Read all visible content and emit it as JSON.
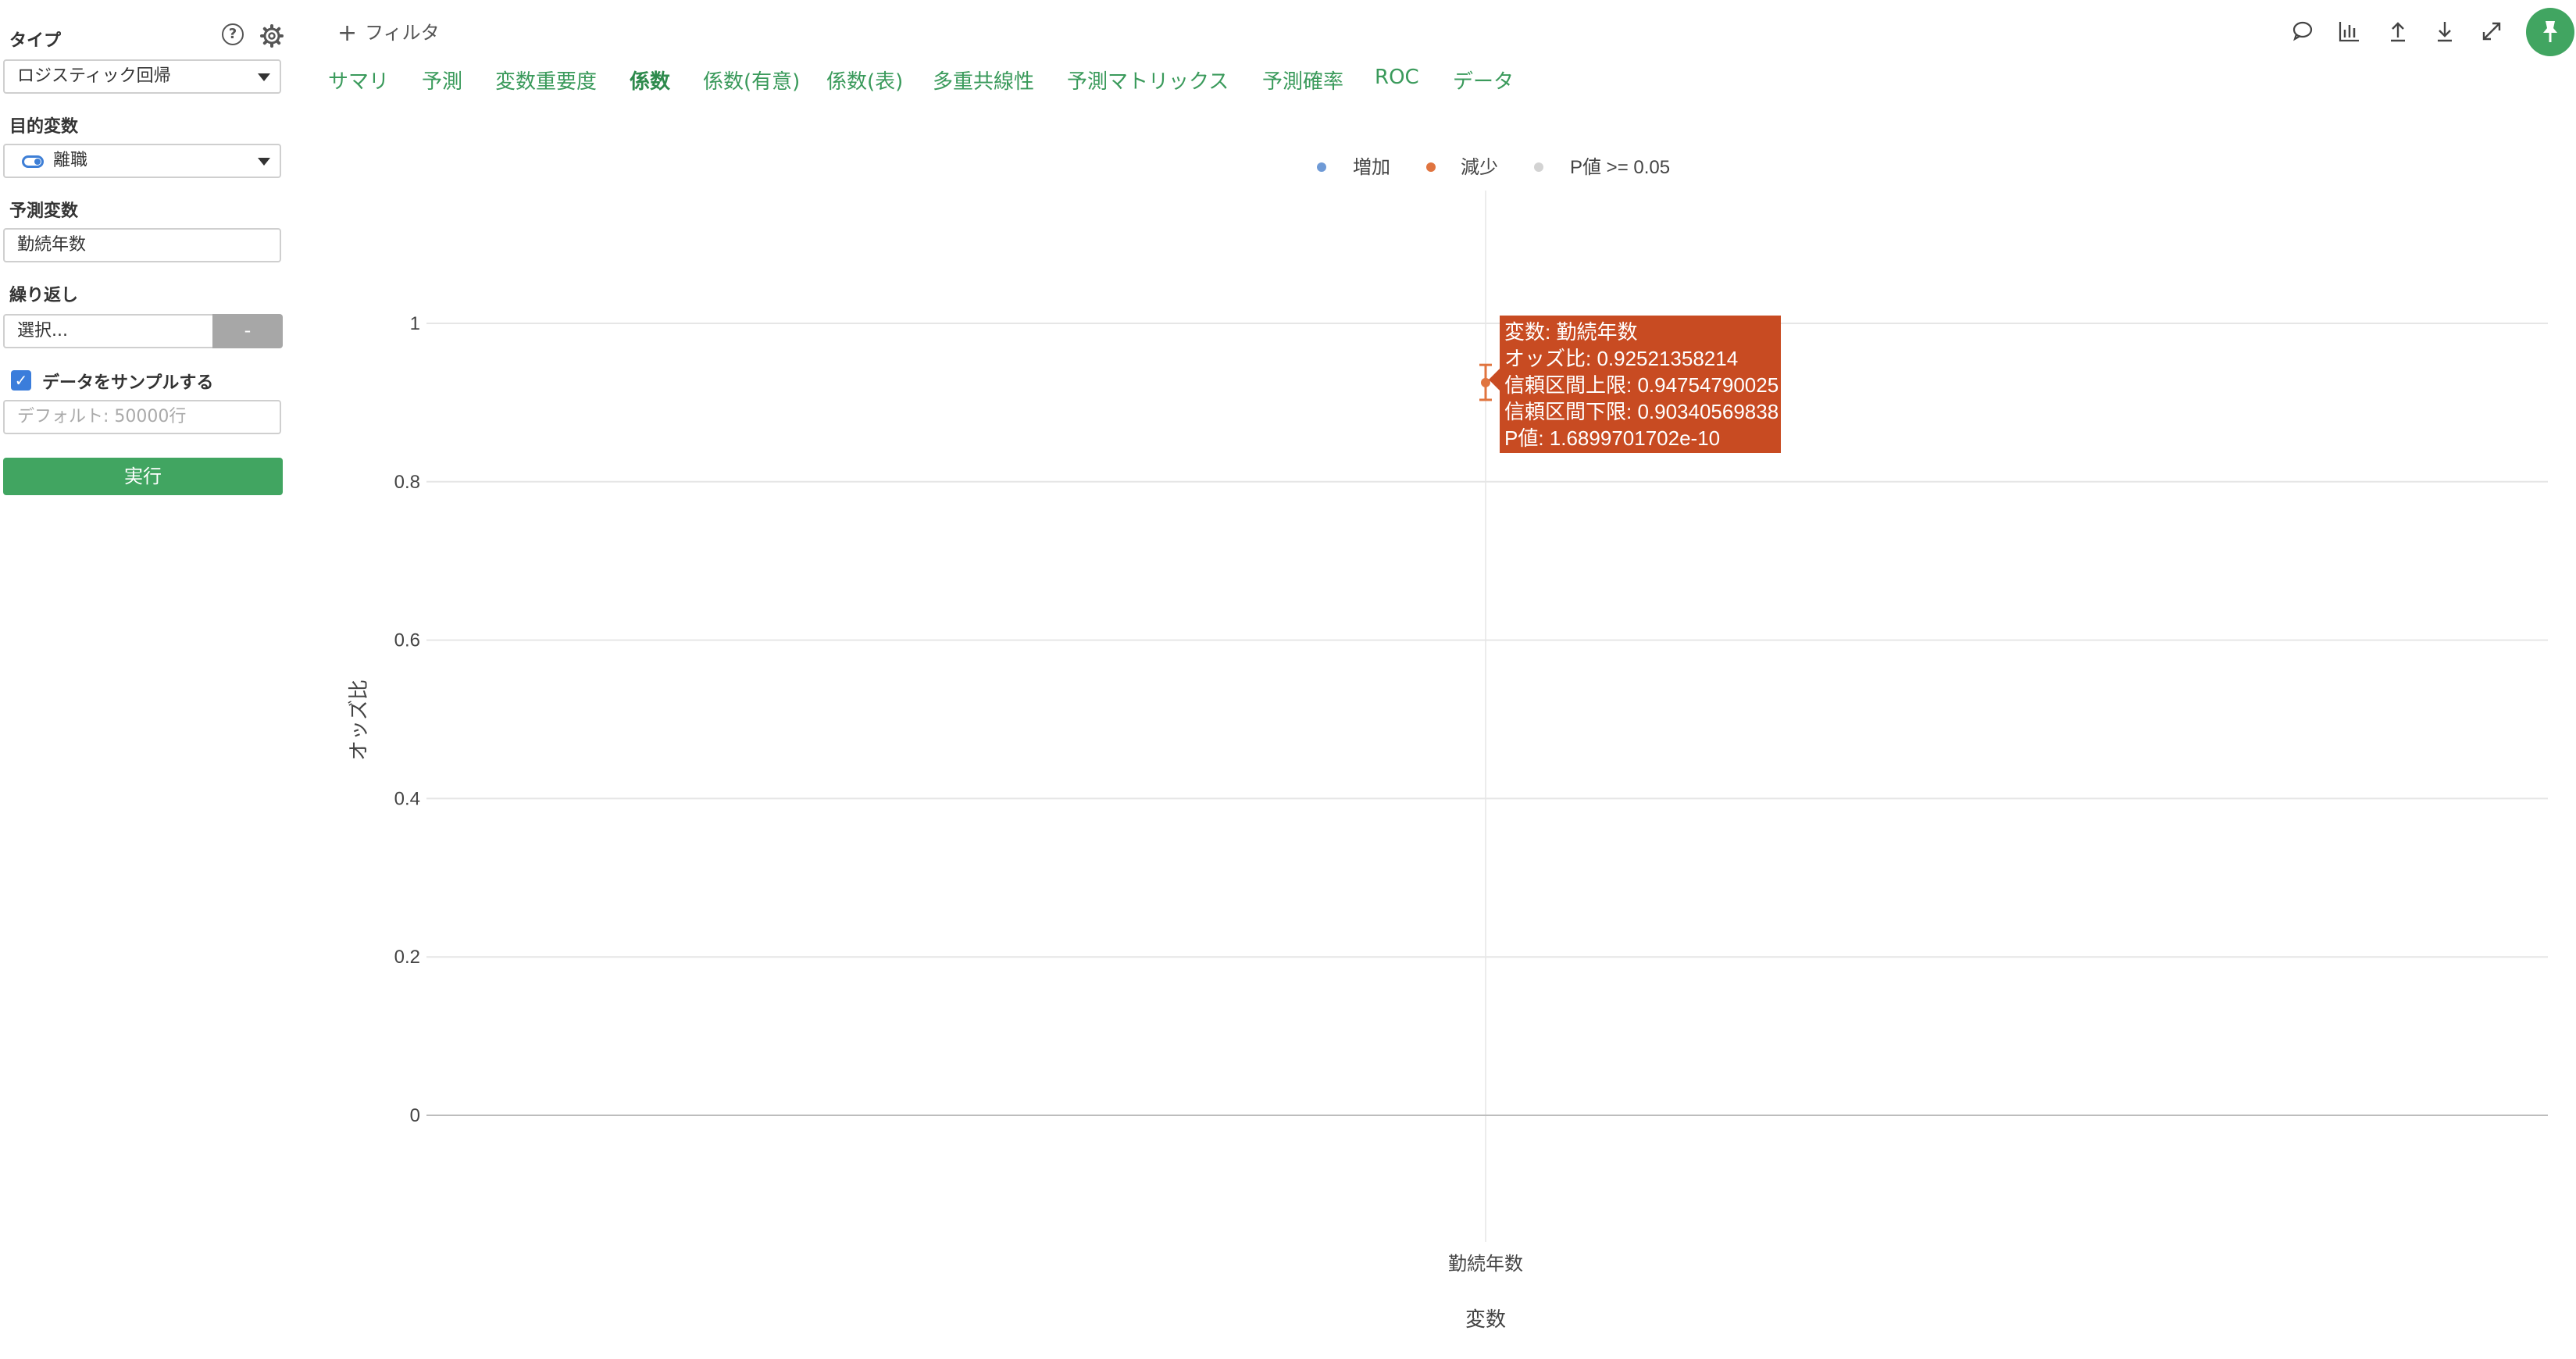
{
  "sidebar": {
    "type_label": "タイプ",
    "help_icon_glyph": "?",
    "type_value": "ロジスティック回帰",
    "target_label": "目的変数",
    "target_value": "離職",
    "predictor_label": "予測変数",
    "predictor_value": "勤続年数",
    "repeat_label": "繰り返し",
    "repeat_placeholder": "選択...",
    "repeat_button": "-",
    "sample_label": "データをサンプルする",
    "sample_checked": true,
    "sample_placeholder": "デフォルト: 50000行",
    "run_label": "実行"
  },
  "header": {
    "filter_label": "フィルタ",
    "tabs": [
      {
        "label": "サマリ"
      },
      {
        "label": "予測"
      },
      {
        "label": "変数重要度"
      },
      {
        "label": "係数",
        "active": true
      },
      {
        "label": "係数(有意)"
      },
      {
        "label": "係数(表)"
      },
      {
        "label": "多重共線性"
      },
      {
        "label": "予測マトリックス"
      },
      {
        "label": "予測確率"
      },
      {
        "label": "ROC"
      },
      {
        "label": "データ"
      }
    ],
    "toolbar_icons": [
      "comment-icon",
      "chart-icon",
      "upload-icon",
      "download-icon",
      "expand-icon",
      "pin-icon"
    ]
  },
  "colors": {
    "accent": "#41a561",
    "tab_text": "#3a9a5b",
    "increase": "#6f9ad6",
    "decrease": "#e0743f",
    "not_significant": "#d3d3d3",
    "tooltip_bg": "#c84b22",
    "checkbox": "#3b7ddb"
  },
  "chart_data": {
    "type": "scatter",
    "xlabel": "変数",
    "ylabel": "オッズ比",
    "ylim": [
      0,
      1.1
    ],
    "yticks": [
      0,
      0.2,
      0.4,
      0.6,
      0.8,
      1
    ],
    "ytick_labels": [
      "0",
      "0.2",
      "0.4",
      "0.6",
      "0.8",
      "1"
    ],
    "categories": [
      "勤続年数"
    ],
    "legend": [
      {
        "name": "増加",
        "color": "#6f9ad6"
      },
      {
        "name": "減少",
        "color": "#e0743f"
      },
      {
        "name": "P値 >= 0.05",
        "color": "#d3d3d3"
      }
    ],
    "legend_position": "top-center",
    "grid": true,
    "points": [
      {
        "category": "勤続年数",
        "series": "減少",
        "odds_ratio": 0.92521358214,
        "upper": 0.94754790025,
        "lower": 0.90340569838,
        "p_value": "1.6899701702e-10"
      }
    ],
    "tooltip": {
      "lines": [
        "変数: 勤続年数",
        "オッズ比: 0.92521358214",
        "信頼区間上限: 0.94754790025",
        "信頼区間下限: 0.90340569838",
        "P値: 1.6899701702e-10"
      ]
    }
  }
}
